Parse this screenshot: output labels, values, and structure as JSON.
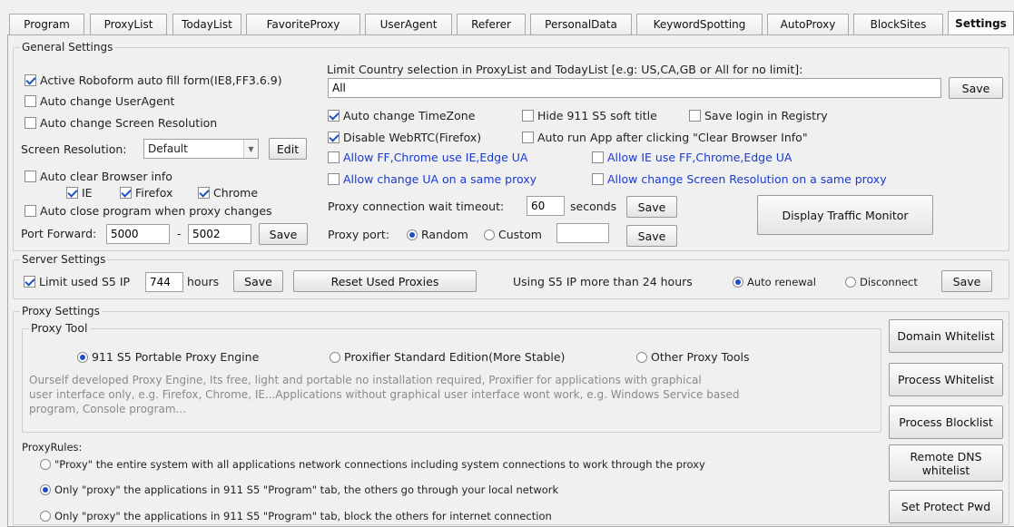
{
  "tabs": [
    "Program",
    "ProxyList",
    "TodayList",
    "FavoriteProxy",
    "UserAgent",
    "Referer",
    "PersonalData",
    "KeywordSpotting",
    "AutoProxy",
    "BlockSites",
    "Settings"
  ],
  "active_tab": "Settings",
  "general": {
    "title": "General Settings",
    "roboform": "Active Roboform auto fill form(IE8,FF3.6.9)",
    "auto_ua": "Auto change UserAgent",
    "auto_res": "Auto change Screen Resolution",
    "screen_res_label": "Screen Resolution:",
    "screen_res_value": "Default",
    "edit_btn": "Edit",
    "auto_clear": "Auto clear Browser info",
    "ie": "IE",
    "firefox": "Firefox",
    "chrome": "Chrome",
    "auto_close": "Auto close program when proxy changes",
    "port_forward_label": "Port Forward:",
    "port_from": "5000",
    "port_dash": "-",
    "port_to": "5002",
    "save": "Save",
    "limit_country_label": "Limit Country selection in ProxyList and TodayList [e.g:  US,CA,GB  or All for no limit]:",
    "limit_country_value": "All",
    "auto_timezone": "Auto change TimeZone",
    "hide_title": "Hide 911 S5 soft title",
    "save_login": "Save login in Registry",
    "disable_webrtc": "Disable WebRTC(Firefox)",
    "auto_run": "Auto run App after clicking \"Clear Browser Info\"",
    "allow_ff_chrome": "Allow FF,Chrome use IE,Edge UA",
    "allow_ie": "Allow IE use FF,Chrome,Edge UA",
    "allow_ua_same": "Allow change UA on a same proxy",
    "allow_res_same": "Allow change Screen Resolution on a same proxy",
    "timeout_label": "Proxy connection wait timeout:",
    "timeout_value": "60",
    "seconds": "seconds",
    "display_traffic": "Display Traffic Monitor",
    "proxy_port_label": "Proxy port:",
    "random": "Random",
    "custom": "Custom",
    "custom_value": ""
  },
  "server": {
    "title": "Server Settings",
    "limit_s5": "Limit used S5 IP",
    "hours_value": "744",
    "hours": "hours",
    "save": "Save",
    "reset": "Reset Used Proxies",
    "using_label": "Using S5 IP more than 24 hours",
    "auto_renewal": "Auto renewal",
    "disconnect": "Disconnect"
  },
  "proxy": {
    "title": "Proxy Settings",
    "tool_title": "Proxy Tool",
    "engine": "911 S5 Portable Proxy Engine",
    "proxifier": "Proxifier Standard Edition(More Stable)",
    "other": "Other Proxy Tools",
    "desc1": "Ourself developed Proxy Engine, Its free, light and portable no installation required, Proxifier for applications with graphical",
    "desc2": "user interface only, e.g. Firefox, Chrome, IE...Applications without graphical user interface wont work, e.g. Windows Service based",
    "desc3": "program, Console program...",
    "rules_title": "ProxyRules:",
    "rule1": "\"Proxy\" the entire system with all applications network connections including system connections to work through the proxy",
    "rule2": "Only \"proxy\" the applications in 911 S5 \"Program\" tab, the others go through your local network",
    "rule3": "Only \"proxy\" the applications in 911 S5 \"Program\" tab, block the others for internet connection"
  },
  "side_buttons": {
    "domain_whitelist": "Domain Whitelist",
    "process_whitelist": "Process Whitelist",
    "process_blocklist": "Process Blocklist",
    "remote_dns_1": "Remote DNS",
    "remote_dns_2": "whitelist",
    "set_protect": "Set Protect Pwd"
  }
}
